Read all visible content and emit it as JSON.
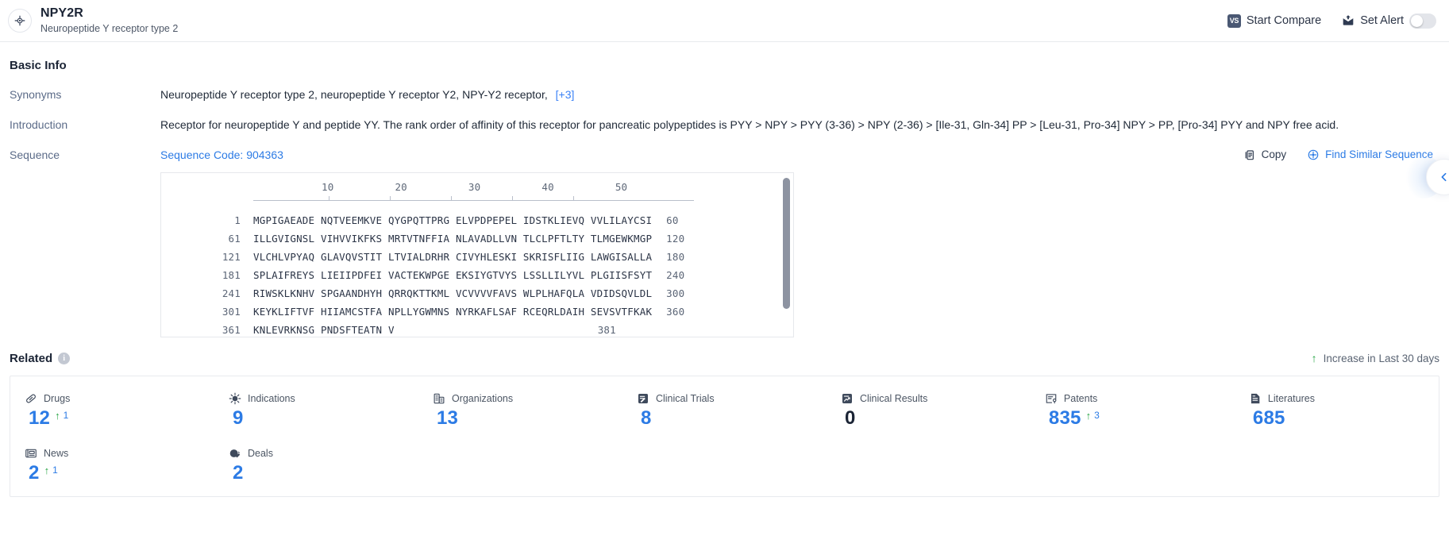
{
  "header": {
    "target_icon": "target-crosshair-icon",
    "gene_name": "NPY2R",
    "gene_full_name": "Neuropeptide Y receptor type 2",
    "compare_label": "Start Compare",
    "compare_icon_text": "VS",
    "alert_label": "Set Alert",
    "alert_icon": "alert-envelope-icon",
    "alert_toggle_state": "off"
  },
  "basic_info": {
    "section_title": "Basic Info",
    "synonyms_label": "Synonyms",
    "synonyms_value": "Neuropeptide Y receptor type 2,  neuropeptide Y receptor Y2,  NPY-Y2 receptor,",
    "synonyms_more": "[+3]",
    "introduction_label": "Introduction",
    "introduction_value": "Receptor for neuropeptide Y and peptide YY. The rank order of affinity of this receptor for pancreatic polypeptides is PYY > NPY > PYY (3-36) > NPY (2-36) > [Ile-31, Gln-34] PP > [Leu-31, Pro-34] NPY > PP, [Pro-34] PYY and NPY free acid.",
    "sequence_label": "Sequence",
    "sequence_code": "Sequence Code: 904363",
    "copy_label": "Copy",
    "copy_icon": "copy-icon",
    "find_similar_label": "Find Similar Sequence",
    "find_similar_icon": "find-similar-icon"
  },
  "sequence": {
    "ruler_ticks": [
      "10",
      "20",
      "30",
      "40",
      "50"
    ],
    "rows": [
      {
        "start": "1",
        "chunks": "MGPIGAEADE NQTVEEMKVE QYGPQTTPRG ELVPDPEPEL IDSTKLIEVQ VVLILAYCSI",
        "end": "60"
      },
      {
        "start": "61",
        "chunks": "ILLGVIGNSL VIHVVIKFKS MRTVTNFFIA NLAVADLLVN TLCLPFTLTY TLMGEWKMGP",
        "end": "120"
      },
      {
        "start": "121",
        "chunks": "VLCHLVPYAQ GLAVQVSTIT LTVIALDRHR CIVYHLESKI SKRISFLIIG LAWGISALLA",
        "end": "180"
      },
      {
        "start": "181",
        "chunks": "SPLAIFREYS LIEIIPDFEI VACTEKWPGE EKSIYGTVYS LSSLLILYVL PLGIISFSYT",
        "end": "240"
      },
      {
        "start": "241",
        "chunks": "RIWSKLKNHV SPGAANDHYH QRRQKTTKML VCVVVVFAVS WLPLHAFQLA VDIDSQVLDL",
        "end": "300"
      },
      {
        "start": "301",
        "chunks": "KEYKLIFTVF HIIAMCSTFA NPLLYGWMNS NYRKAFLSAF RCEQRLDAIH SEVSVTFKAK",
        "end": "360"
      },
      {
        "start": "361",
        "chunks": "KNLEVRKNSG PNDSFTEATN V",
        "end": "381"
      }
    ]
  },
  "related": {
    "title": "Related",
    "info_icon": "info-icon",
    "legend_text": "Increase in Last 30 days",
    "legend_icon": "arrow-up-icon",
    "cards": [
      {
        "label": "Drugs",
        "icon": "capsule-icon",
        "value": "12",
        "delta": "1",
        "is_zero": false
      },
      {
        "label": "Indications",
        "icon": "virus-icon",
        "value": "9",
        "delta": "",
        "is_zero": false
      },
      {
        "label": "Organizations",
        "icon": "building-icon",
        "value": "13",
        "delta": "",
        "is_zero": false
      },
      {
        "label": "Clinical Trials",
        "icon": "trial-doc-icon",
        "value": "8",
        "delta": "",
        "is_zero": false
      },
      {
        "label": "Clinical Results",
        "icon": "results-chart-icon",
        "value": "0",
        "delta": "",
        "is_zero": true
      },
      {
        "label": "Patents",
        "icon": "patent-icon",
        "value": "835",
        "delta": "3",
        "is_zero": false
      },
      {
        "label": "Literatures",
        "icon": "literature-icon",
        "value": "685",
        "delta": "",
        "is_zero": false
      },
      {
        "label": "News",
        "icon": "news-icon",
        "value": "2",
        "delta": "1",
        "is_zero": false
      },
      {
        "label": "Deals",
        "icon": "deals-icon",
        "value": "2",
        "delta": "",
        "is_zero": false
      }
    ]
  },
  "colors": {
    "link_blue": "#2c7be5",
    "increase_green": "#27a544",
    "label_slate": "#5b6b88",
    "heading": "#1b2435"
  }
}
